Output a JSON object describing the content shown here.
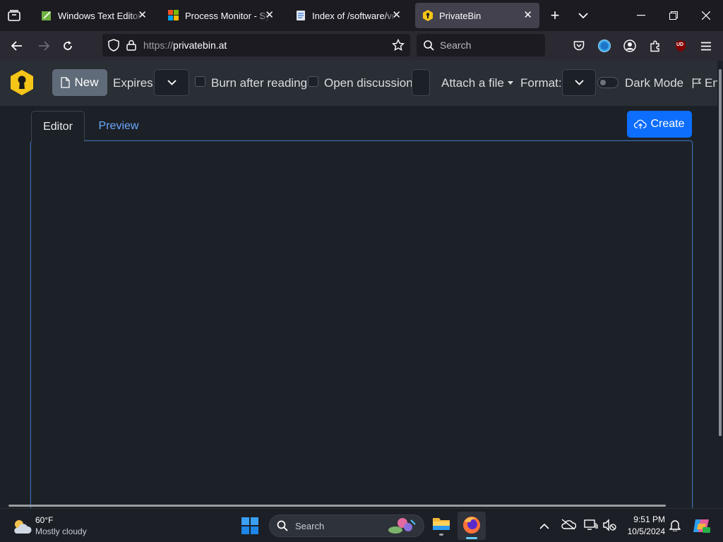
{
  "browser": {
    "tabs": [
      {
        "title": "Windows Text Editor Fo",
        "active": false
      },
      {
        "title": "Process Monitor - Sysin",
        "active": false
      },
      {
        "title": "Index of /software/vmw",
        "active": false
      },
      {
        "title": "PrivateBin",
        "active": true
      }
    ],
    "url": "https://privatebin.at",
    "url_prefix": "https://",
    "url_domain": "privatebin.at",
    "search_placeholder": "Search",
    "extension_badge": "UD"
  },
  "toolbar": {
    "new_label": "New",
    "expires_label": "Expires:",
    "burn_label": "Burn after reading",
    "discussion_label": "Open discussion",
    "attach_label": "Attach a file",
    "format_label": "Format:",
    "darkmode_label": "Dark Mode",
    "language_label": "Eng"
  },
  "editor": {
    "tab_editor": "Editor",
    "tab_preview": "Preview",
    "create_label": "Create",
    "content": ""
  },
  "taskbar": {
    "weather_temp": "60°F",
    "weather_desc": "Mostly cloudy",
    "search_label": "Search",
    "time": "9:51 PM",
    "date": "10/5/2024"
  },
  "colors": {
    "accent_blue": "#0d6efd",
    "privatebin_yellow": "#f5c518",
    "link_blue": "#6ea8fe"
  }
}
